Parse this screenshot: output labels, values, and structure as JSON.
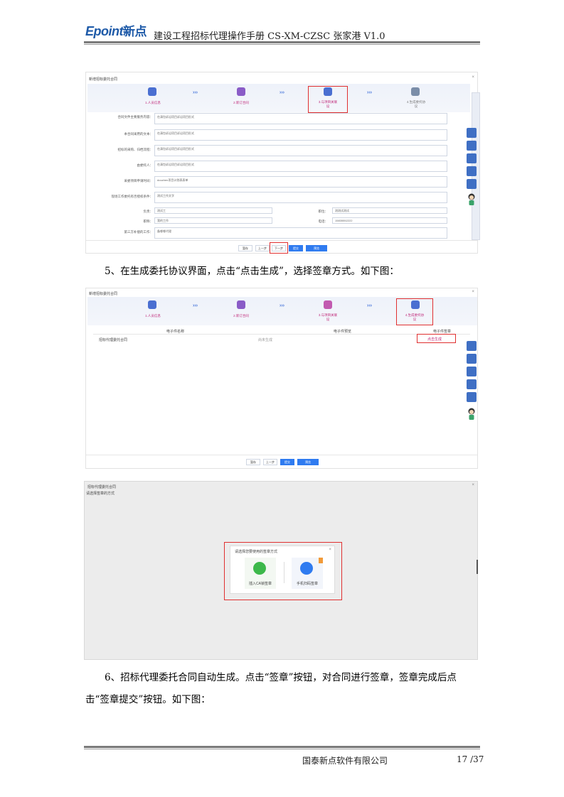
{
  "header": {
    "logo_text": "Epoint",
    "logo_cn": "新点",
    "doc_title": "建设工程招标代理操作手册 CS-XM-CZSC 张家港 V1.0"
  },
  "shot1": {
    "title": "新增招标委托合同",
    "steps": [
      "1.人员信息",
      "2.新订合同",
      "3.与项目关联\n设",
      "4.生成委托协\n议"
    ],
    "fields": [
      {
        "label": "合同文件主要服务内容：",
        "value": "在清包诉讼项目诉讼项目形式"
      },
      {
        "label": "本合同采用的文本：",
        "value": "在清包诉讼项目诉讼项目形式"
      },
      {
        "label": "招标的采购、归档流程：",
        "value": "在清包诉讼项目诉讼项目形式"
      },
      {
        "label": "由委托人：",
        "value": "在清包诉讼项目诉讼项目形式"
      },
      {
        "label": "采委项目申请时间：",
        "value": "douchen项目计划表表单"
      },
      {
        "label": "现场工作委托有否授权条件：",
        "value": "测试工作文字"
      }
    ],
    "pair1": {
      "l_label": "负责：",
      "l_value": "测试工",
      "r_label": "职位：",
      "r_value": "测测试测试"
    },
    "pair2": {
      "l_label": "职称：",
      "l_value": "我的工作",
      "r_label": "电话：",
      "r_value": "15835552222"
    },
    "last": {
      "label": "第三方补偿的工作：",
      "value": "备哪哪代理"
    },
    "buttons": [
      "暂存",
      "上一步",
      "下一步",
      "提交",
      "预览"
    ],
    "side_tools": [
      "填报",
      "帮助说明",
      "检测说明",
      "邮件",
      "流程记录"
    ]
  },
  "para5": "5、在生成委托协议界面，点击“点击生成”，选择签章方式。如下图：",
  "shot2": {
    "title": "新增招标委托合同",
    "steps": [
      "1.人员信息",
      "2.新订合同",
      "3.与项目关联\n设",
      "4.生成委托协\n议"
    ],
    "table_headers": [
      "电子件名称",
      "电子件预览",
      "电子件签章"
    ],
    "row": {
      "name": "招标代理委托合同",
      "preview": "尚未生成",
      "action": "点击生成"
    },
    "buttons": [
      "暂存",
      "上一步",
      "提交",
      "预览"
    ],
    "side_tools": [
      "填报",
      "帮助说明",
      "检测说明",
      "邮件",
      "流程记录"
    ]
  },
  "shot3": {
    "title": "招标代理委托合同",
    "subtitle": "请选择签章的方式",
    "dialog_title": "请选择您要使用的签章方式",
    "option1": "插入CA锁签章",
    "option2": "手机扫码签章"
  },
  "para6_line1": "6、招标代理委托合同自动生成。点击“签章”按钮，对合同进行签章，签章完成后点",
  "para6_line2": "击“签章提交”按钮。如下图：",
  "footer": {
    "company": "国泰新点软件有限公司",
    "page": "17 /37"
  },
  "colors": {
    "brand": "#1e5aa8",
    "highlight": "#e03030",
    "accent": "#2f7bf0",
    "step_active": "#c02a7a"
  }
}
